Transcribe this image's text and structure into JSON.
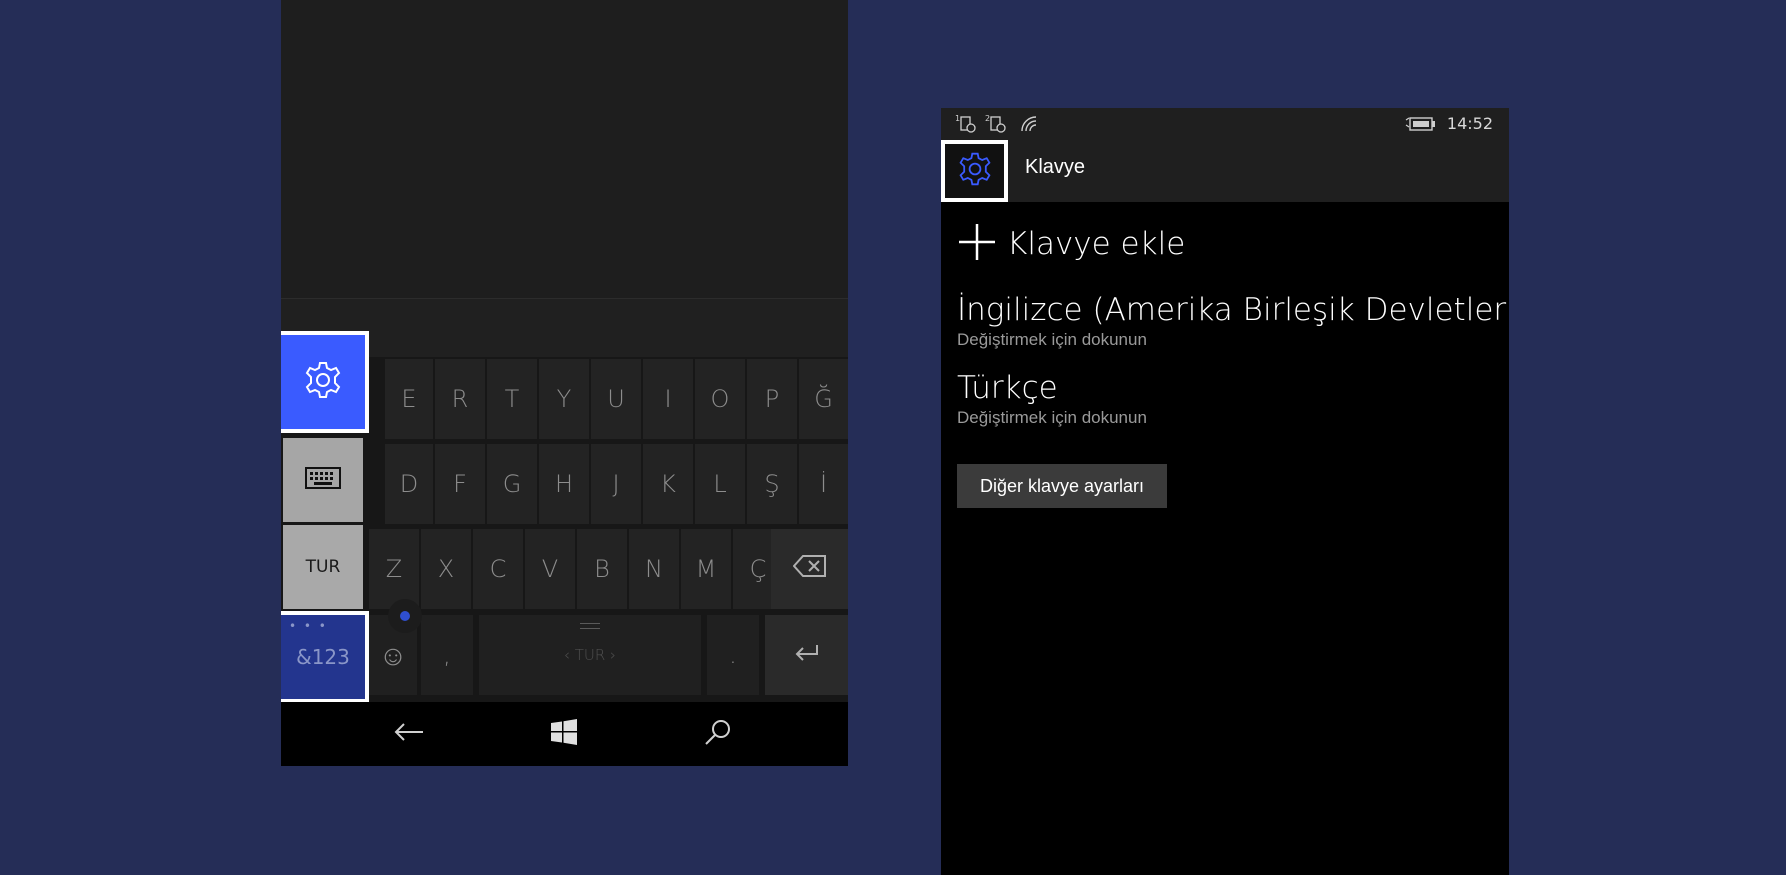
{
  "keyboard": {
    "row1": [
      "E",
      "R",
      "T",
      "Y",
      "U",
      "I",
      "O",
      "P",
      "Ğ"
    ],
    "row2": [
      "D",
      "F",
      "G",
      "H",
      "J",
      "K",
      "L",
      "Ş",
      "İ"
    ],
    "row3": [
      "Z",
      "X",
      "C",
      "V",
      "B",
      "N",
      "M",
      "Ç"
    ],
    "comma": ",",
    "period": ".",
    "space_label": "‹ TUR ›",
    "emoji_label": "☺",
    "backspace_icon": "backspace-icon",
    "enter_icon": "enter-icon"
  },
  "side_menu": {
    "settings_icon": "gear-icon",
    "keyboard_icon": "keyboard-icon",
    "language_label": "TUR",
    "symbols_label": "&123",
    "symbols_dots": "• • •"
  },
  "navbar": {
    "back_icon": "back-arrow-icon",
    "home_icon": "windows-icon",
    "search_icon": "search-icon"
  },
  "settings_screen": {
    "status": {
      "time": "14:52",
      "sim1_label": "1",
      "sim2_label": "2"
    },
    "header_title": "Klavye",
    "add_keyboard": "Klavye ekle",
    "languages": [
      {
        "name": "İngilizce (Amerika Birleşik Devletleri)",
        "subtitle": "Değiştirmek için dokunun"
      },
      {
        "name": "Türkçe",
        "subtitle": "Değiştirmek için dokunun"
      }
    ],
    "more_settings_button": "Diğer klavye ayarları"
  },
  "colors": {
    "background": "#252d57",
    "accent": "#3a5bff",
    "accent_dark": "#23358e"
  }
}
